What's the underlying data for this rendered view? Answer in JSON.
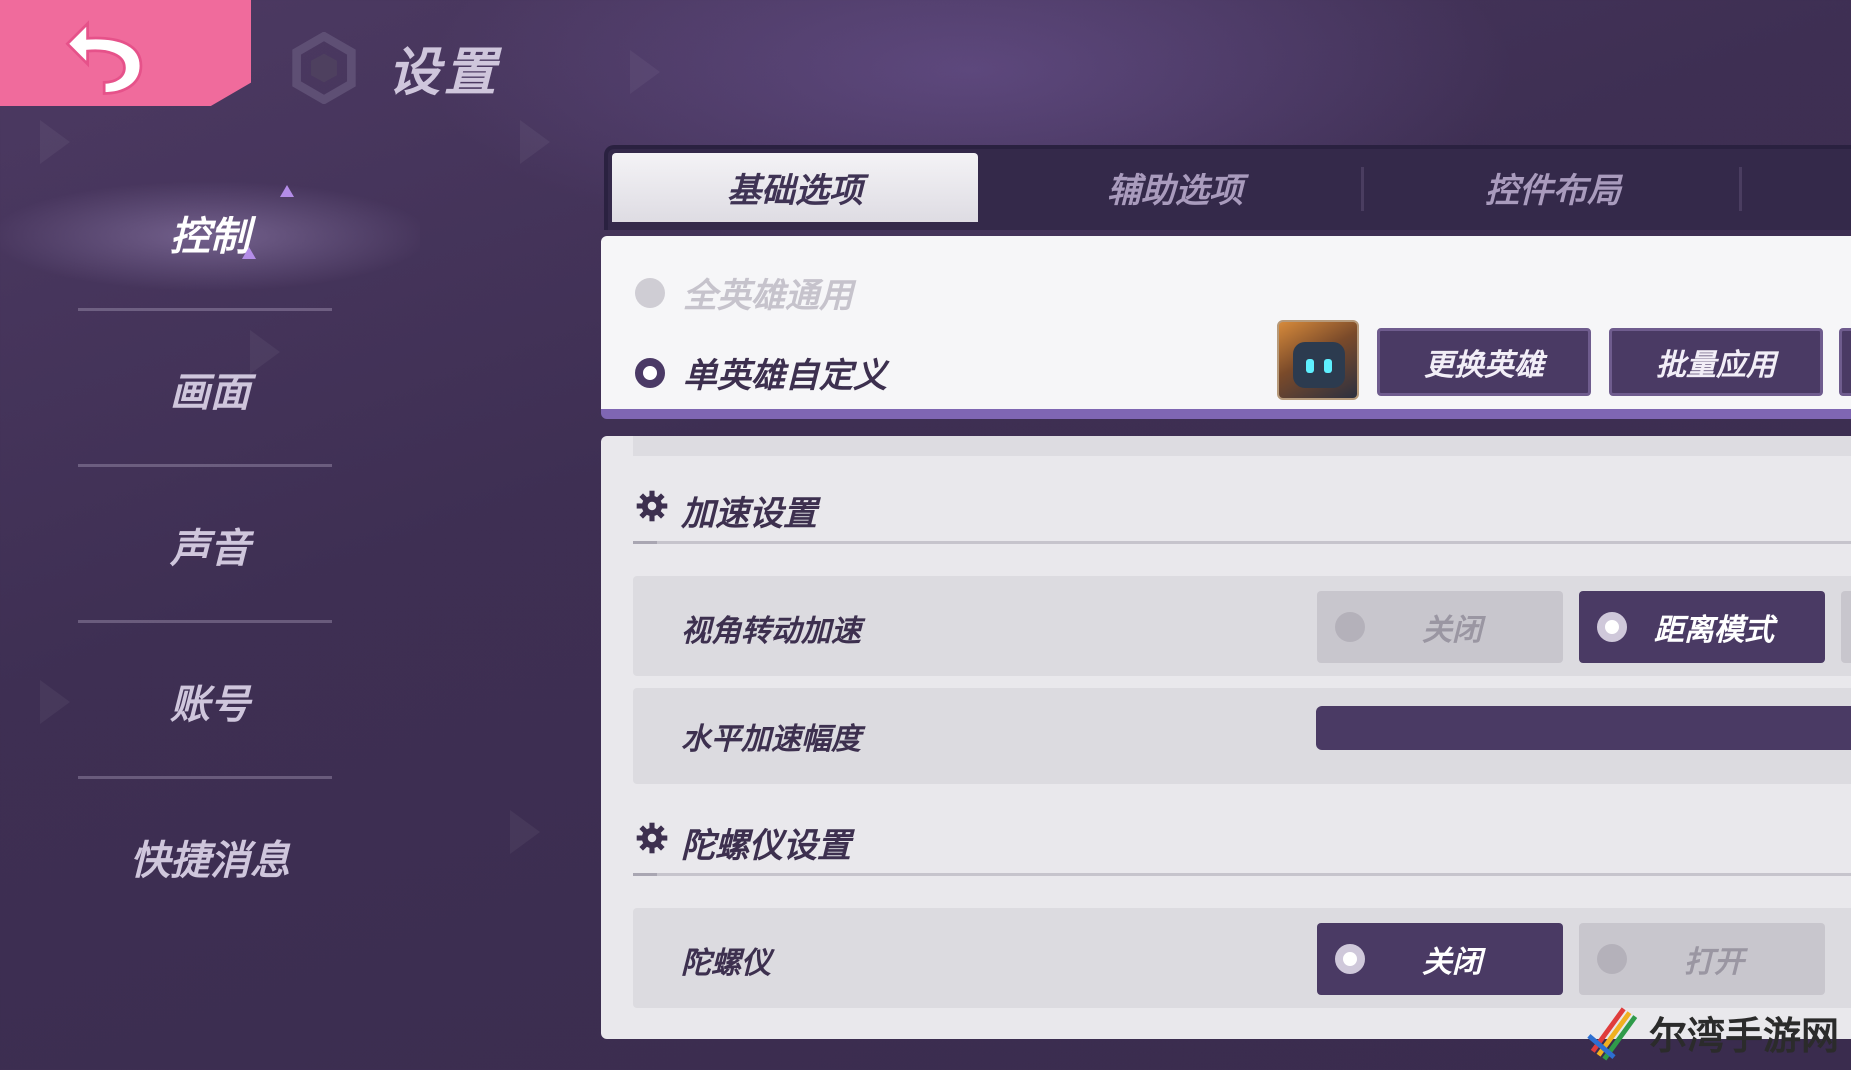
{
  "page": {
    "title": "设置"
  },
  "sidebar": {
    "items": [
      {
        "label": "控制",
        "active": true
      },
      {
        "label": "画面",
        "active": false
      },
      {
        "label": "声音",
        "active": false
      },
      {
        "label": "账号",
        "active": false
      },
      {
        "label": "快捷消息",
        "active": false
      }
    ]
  },
  "tabs": [
    {
      "label": "基础选项",
      "active": true
    },
    {
      "label": "辅助选项",
      "active": false
    },
    {
      "label": "控件布局",
      "active": false
    }
  ],
  "hero_mode": {
    "options": [
      {
        "label": "全英雄通用",
        "selected": false
      },
      {
        "label": "单英雄自定义",
        "selected": true
      }
    ],
    "change_hero_button": "更换英雄",
    "batch_apply_button": "批量应用"
  },
  "acceleration": {
    "section_title": "加速设置",
    "view_rotation": {
      "label": "视角转动加速",
      "options": [
        {
          "label": "关闭",
          "selected": false
        },
        {
          "label": "距离模式",
          "selected": true
        }
      ]
    },
    "horizontal_amplitude": {
      "label": "水平加速幅度"
    }
  },
  "gyroscope": {
    "section_title": "陀螺仪设置",
    "gyro": {
      "label": "陀螺仪",
      "options": [
        {
          "label": "关闭",
          "selected": true
        },
        {
          "label": "打开",
          "selected": false
        }
      ]
    }
  },
  "watermark": {
    "text": "尔湾手游网"
  },
  "colors": {
    "accent": "#4a3a64",
    "back_button": "#f06b9c",
    "panel": "#f6f6f8",
    "highlight": "#7f66b3"
  }
}
